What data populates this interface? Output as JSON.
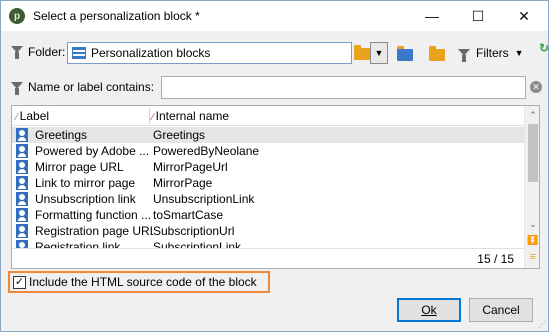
{
  "window": {
    "title": "Select a personalization block *",
    "controls": {
      "minimize": "—",
      "maximize": "☐",
      "close": "✕"
    }
  },
  "toolbar": {
    "folder_label": "Folder:",
    "folder_value": "Personalization blocks",
    "filters_label": "Filters",
    "refresh_glyph": "↻"
  },
  "search": {
    "label": "Name or label contains:",
    "value": "",
    "clear_glyph": "✕"
  },
  "grid": {
    "columns": [
      "Label",
      "Internal name"
    ],
    "rows": [
      {
        "label": "Greetings",
        "name": "Greetings",
        "selected": true
      },
      {
        "label": "Powered by Adobe ...",
        "name": "PoweredByNeolane",
        "selected": false
      },
      {
        "label": "Mirror page URL",
        "name": "MirrorPageUrl",
        "selected": false
      },
      {
        "label": "Link to mirror page",
        "name": "MirrorPage",
        "selected": false
      },
      {
        "label": "Unsubscription link",
        "name": "UnsubscriptionLink",
        "selected": false
      },
      {
        "label": "Formatting function ...",
        "name": "toSmartCase",
        "selected": false
      },
      {
        "label": "Registration page URL",
        "name": "SubscriptionUrl",
        "selected": false
      },
      {
        "label": "Registration link",
        "name": "SubscriptionLink",
        "selected": false
      }
    ],
    "count": "15 / 15"
  },
  "options": {
    "include_html_label": "Include the HTML source code of the block",
    "include_html_checked": true
  },
  "buttons": {
    "ok_label": "Ok",
    "cancel_label": "Cancel"
  },
  "colors": {
    "highlight_border": "#f0883a",
    "icon_blue": "#2f6fbf",
    "folder_orange": "#e8a21c"
  }
}
